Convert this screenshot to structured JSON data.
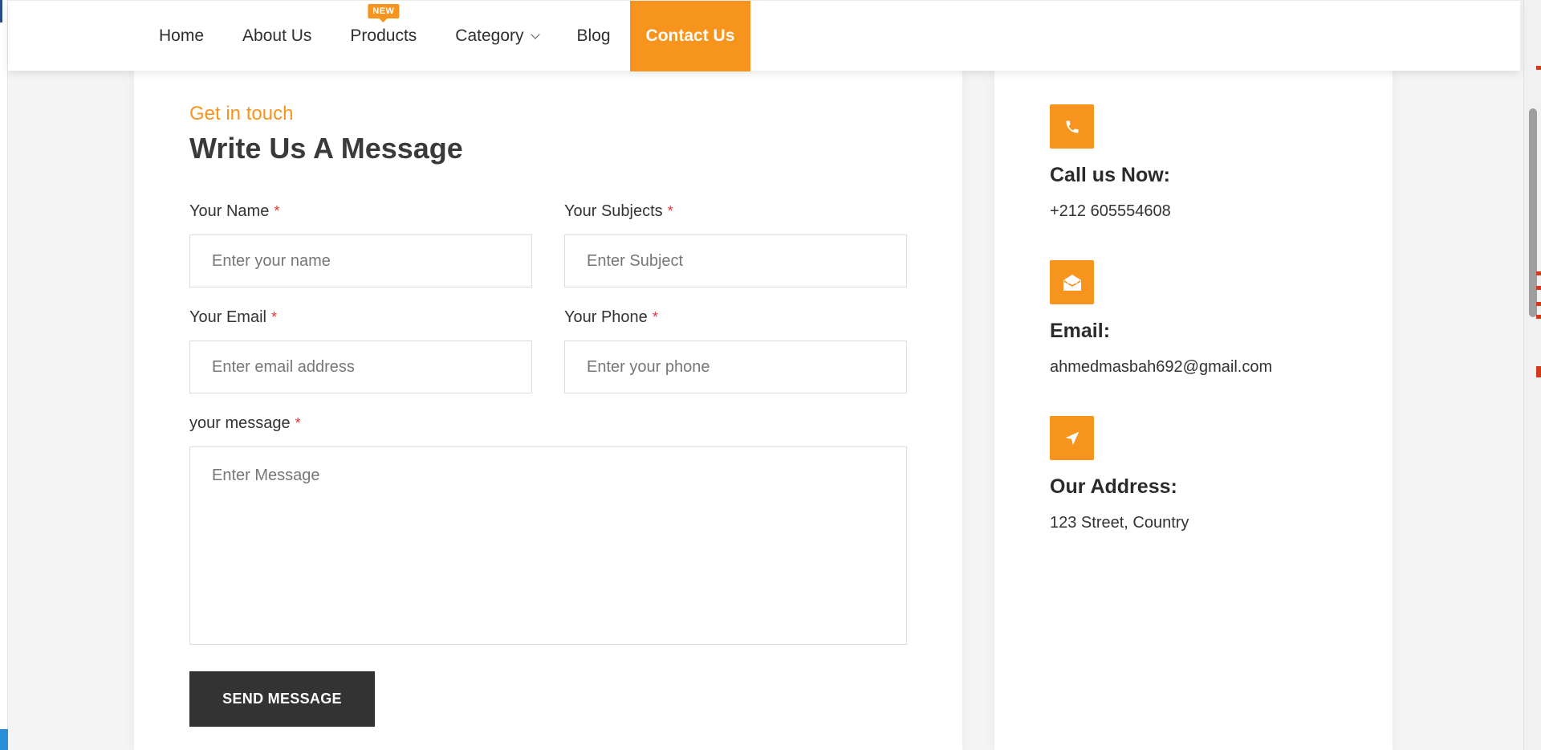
{
  "nav": {
    "items": [
      {
        "label": "Home"
      },
      {
        "label": "About Us"
      },
      {
        "label": "Products",
        "badge": "NEW"
      },
      {
        "label": "Category"
      },
      {
        "label": "Blog"
      },
      {
        "label": "Contact Us"
      }
    ],
    "active": "Contact Us"
  },
  "form": {
    "eyebrow": "Get in touch",
    "heading": "Write Us A Message",
    "required_mark": "*",
    "fields": {
      "name": {
        "label": "Your Name",
        "placeholder": "Enter your name",
        "value": ""
      },
      "subject": {
        "label": "Your Subjects",
        "placeholder": "Enter Subject",
        "value": ""
      },
      "email": {
        "label": "Your Email",
        "placeholder": "Enter email address",
        "value": ""
      },
      "phone": {
        "label": "Your Phone",
        "placeholder": "Enter your phone",
        "value": ""
      },
      "message": {
        "label": "your message",
        "placeholder": "Enter Message",
        "value": ""
      }
    },
    "submit_label": "SEND MESSAGE"
  },
  "contact_info": [
    {
      "icon": "phone-icon",
      "title": "Call us Now:",
      "value": "+212 605554608"
    },
    {
      "icon": "envelope-open-icon",
      "title": "Email:",
      "value": "ahmedmasbah692@gmail.com"
    },
    {
      "icon": "location-arrow-icon",
      "title": "Our Address:",
      "value": "123 Street, Country"
    }
  ],
  "colors": {
    "accent": "#f7941d",
    "button_dark": "#333333",
    "required": "#e53935"
  }
}
